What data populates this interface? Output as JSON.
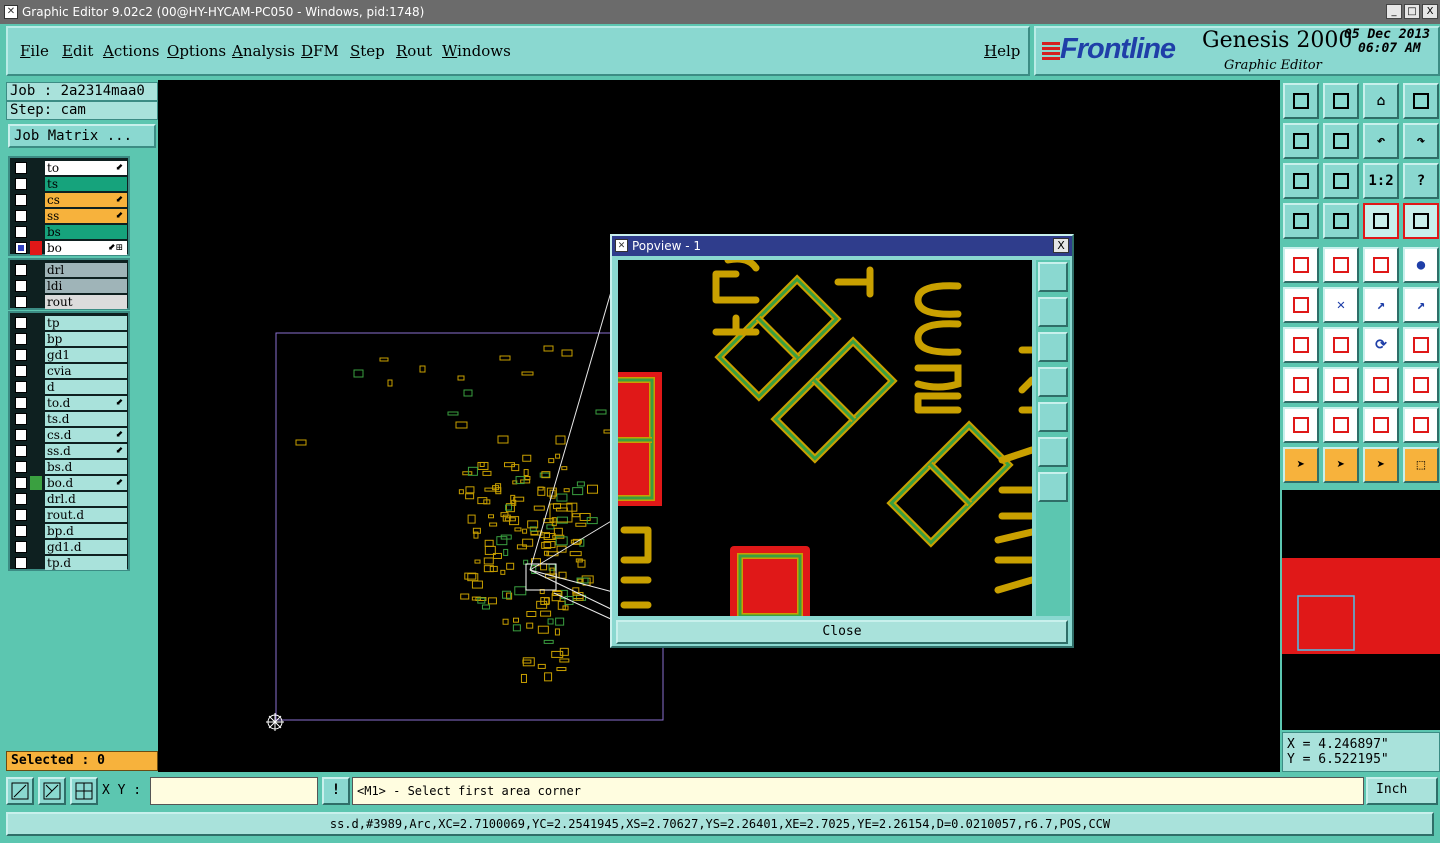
{
  "window": {
    "title": "Graphic Editor 9.02c2 (00@HY-HYCAM-PC050 - Windows, pid:1748)",
    "buttons": [
      "_",
      "□",
      "X"
    ]
  },
  "menu": {
    "items": [
      "File",
      "Edit",
      "Actions",
      "Options",
      "Analysis",
      "DFM",
      "Step",
      "Rout",
      "Windows"
    ],
    "help": "Help"
  },
  "brand": {
    "logo": "Frontline",
    "product": "Genesis 2000",
    "subtitle": "Graphic Editor",
    "date": "05 Dec 2013",
    "time": "06:07 AM"
  },
  "job": {
    "job_label": "Job : 2a2314maa0",
    "step_label": "Step: cam",
    "matrix_button": "Job Matrix ..."
  },
  "layers": {
    "group1": [
      {
        "name": "to",
        "color": "#ffffff",
        "tag": "⬋",
        "checked": false
      },
      {
        "name": "ts",
        "color": "#16a37c",
        "tag": "",
        "checked": false
      },
      {
        "name": "cs",
        "color": "#f7b23c",
        "tag": "⬋",
        "checked": false
      },
      {
        "name": "ss",
        "color": "#f7b23c",
        "tag": "⬋",
        "checked": false
      },
      {
        "name": "bs",
        "color": "#16a37c",
        "tag": "",
        "checked": false
      },
      {
        "name": "bo",
        "color": "#ffffff",
        "tag": "⬋⊞",
        "checked": true,
        "active": true
      }
    ],
    "group2": [
      {
        "name": "drl",
        "color": "#9fb4b8",
        "tag": "",
        "checked": false
      },
      {
        "name": "ldi",
        "color": "#9fb4b8",
        "tag": "",
        "checked": false
      },
      {
        "name": "rout",
        "color": "#dcdcdc",
        "tag": "",
        "checked": false
      }
    ],
    "group3": [
      {
        "name": "tp",
        "color": "#a9e2db",
        "tag": "",
        "checked": false
      },
      {
        "name": "bp",
        "color": "#a9e2db",
        "tag": "",
        "checked": false
      },
      {
        "name": "gd1",
        "color": "#a9e2db",
        "tag": "",
        "checked": false
      },
      {
        "name": "cvia",
        "color": "#a9e2db",
        "tag": "",
        "checked": false
      },
      {
        "name": "d",
        "color": "#a9e2db",
        "tag": "",
        "checked": false
      },
      {
        "name": "to.d",
        "color": "#a9e2db",
        "tag": "⬋",
        "checked": false
      },
      {
        "name": "ts.d",
        "color": "#a9e2db",
        "tag": "",
        "checked": false
      },
      {
        "name": "cs.d",
        "color": "#a9e2db",
        "tag": "⬋",
        "checked": false
      },
      {
        "name": "ss.d",
        "color": "#a9e2db",
        "tag": "⬋",
        "checked": false
      },
      {
        "name": "bs.d",
        "color": "#a9e2db",
        "tag": "",
        "checked": false
      },
      {
        "name": "bo.d",
        "color": "#a9e2db",
        "tag": "⬋",
        "checked": false,
        "indicator": "#3aa040"
      },
      {
        "name": "drl.d",
        "color": "#a9e2db",
        "tag": "",
        "checked": false
      },
      {
        "name": "rout.d",
        "color": "#a9e2db",
        "tag": "",
        "checked": false
      },
      {
        "name": "bp.d",
        "color": "#a9e2db",
        "tag": "",
        "checked": false
      },
      {
        "name": "gd1.d",
        "color": "#a9e2db",
        "tag": "",
        "checked": false
      },
      {
        "name": "tp.d",
        "color": "#a9e2db",
        "tag": "",
        "checked": false
      }
    ]
  },
  "selected": "Selected : 0",
  "popview": {
    "title": "Popview - 1",
    "close_label": "Close",
    "close_x": "X"
  },
  "coords": {
    "x": "X = 4.246897\"",
    "y": "Y = 6.522195\""
  },
  "bottom": {
    "xy_label": "X Y :",
    "xy_value": "",
    "mode_icon": "!",
    "message": "<M1> - Select first area corner",
    "unit": "Inch"
  },
  "status": "ss.d,#3989,Arc,XC=2.7100069,YC=2.2541945,XS=2.70627,YS=2.26401,XE=2.7025,YE=2.26154,D=0.0210057,r6.7,POS,CCW",
  "colors": {
    "teal": "#5cc6b0",
    "panel": "#8ad8d0",
    "board_outline": "#8a70d0",
    "pad_yellow": "#c9a000",
    "pad_green": "#3aa040",
    "pad_red": "#e01818"
  }
}
